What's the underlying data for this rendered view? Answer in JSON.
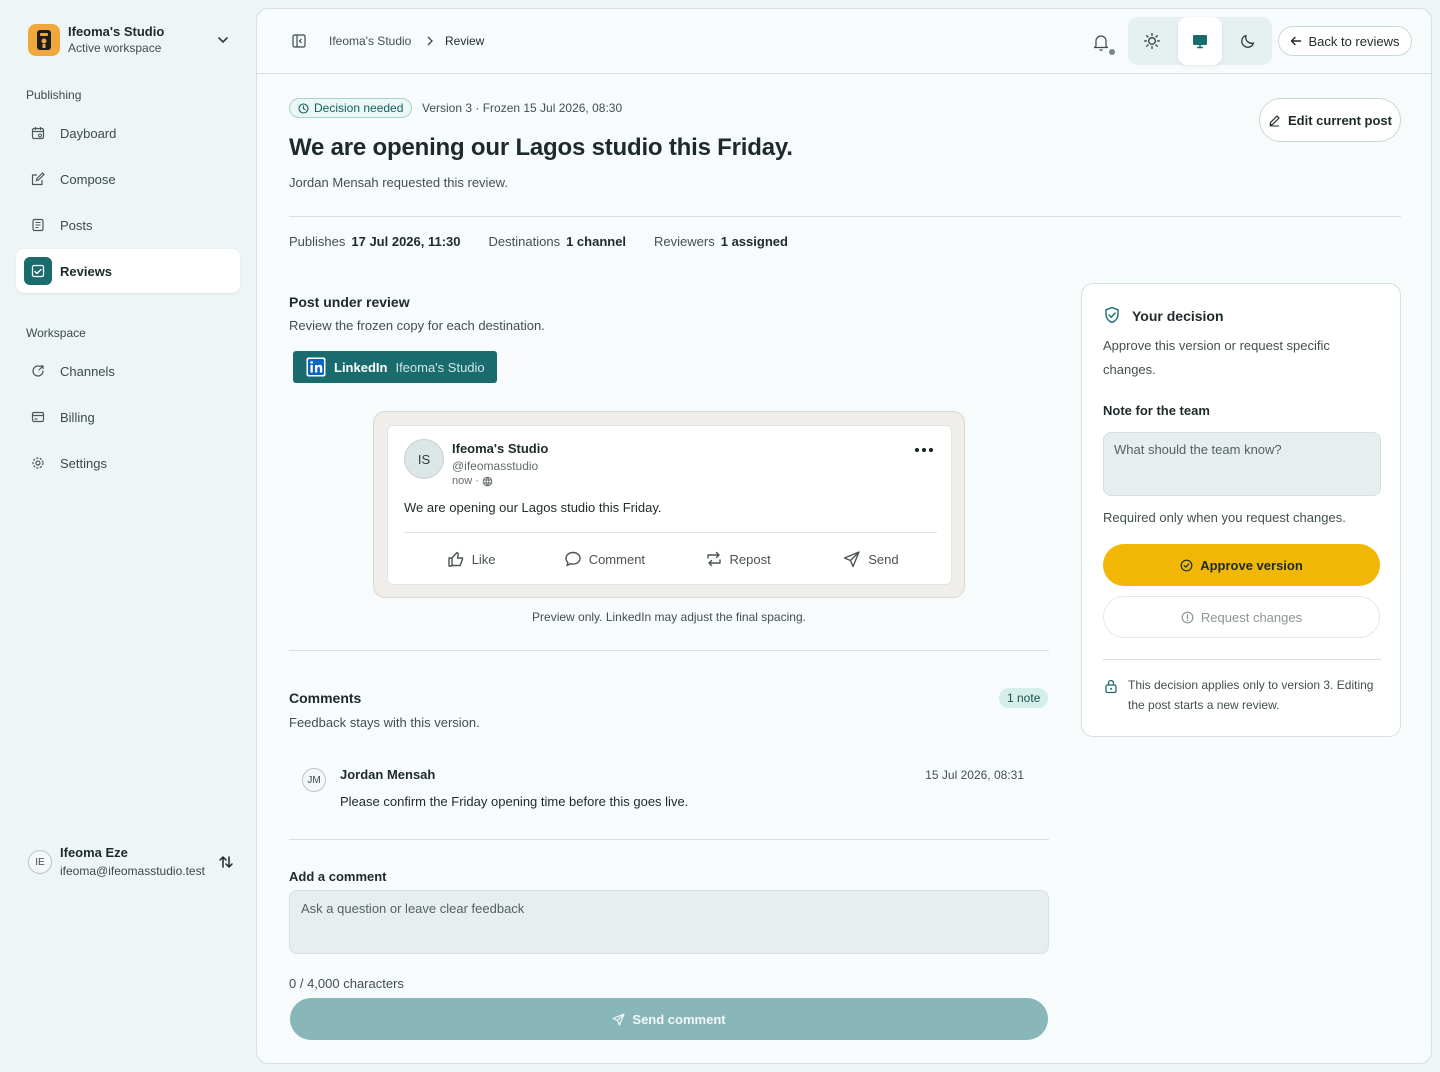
{
  "workspace": {
    "name": "Ifeoma's Studio",
    "subtitle": "Active workspace"
  },
  "nav": {
    "publishing_label": "Publishing",
    "workspace_label": "Workspace",
    "items": [
      {
        "label": "Dayboard",
        "icon": "calendar-icon"
      },
      {
        "label": "Compose",
        "icon": "compose-icon"
      },
      {
        "label": "Posts",
        "icon": "posts-icon"
      },
      {
        "label": "Reviews",
        "icon": "reviews-icon",
        "active": true
      },
      {
        "label": "Channels",
        "icon": "channels-icon"
      },
      {
        "label": "Billing",
        "icon": "billing-icon"
      },
      {
        "label": "Settings",
        "icon": "gear-icon"
      }
    ]
  },
  "user": {
    "initials": "IE",
    "name": "Ifeoma Eze",
    "email": "ifeoma@ifeomasstudio.test"
  },
  "topbar": {
    "breadcrumb": {
      "workspace": "Ifeoma's Studio",
      "current": "Review"
    },
    "theme_selected": "system",
    "back_label": "Back to reviews"
  },
  "review": {
    "status_badge": "Decision needed",
    "version_meta": "Version 3 · Frozen 15 Jul 2026, 08:30",
    "title": "We are opening our Lagos studio this Friday.",
    "requested_by": "Jordan Mensah requested this review.",
    "edit_label": "Edit current post",
    "meta": {
      "publishes_label": "Publishes",
      "publishes_value": "17 Jul 2026, 11:30",
      "destinations_label": "Destinations",
      "destinations_value": "1 channel",
      "reviewers_label": "Reviewers",
      "reviewers_value": "1 assigned"
    }
  },
  "post_review": {
    "title": "Post under review",
    "subtitle": "Review the frozen copy for each destination.",
    "channel": {
      "network": "LinkedIn",
      "account": "Ifeoma's Studio"
    },
    "preview": {
      "initials": "IS",
      "name": "Ifeoma's Studio",
      "handle": "@ifeomasstudio",
      "time": "now ·",
      "text": "We are opening our Lagos studio this Friday.",
      "actions": [
        "Like",
        "Comment",
        "Repost",
        "Send"
      ]
    },
    "note": "Preview only. LinkedIn may adjust the final spacing."
  },
  "comments": {
    "title": "Comments",
    "subtitle": "Feedback stays with this version.",
    "count_badge": "1 note",
    "items": [
      {
        "initials": "JM",
        "author": "Jordan Mensah",
        "time": "15 Jul 2026, 08:31",
        "text": "Please confirm the Friday opening time before this goes live."
      }
    ],
    "add_label": "Add a comment",
    "placeholder": "Ask a question or leave clear feedback",
    "char_count": "0 / 4,000 characters",
    "send_label": "Send comment"
  },
  "decision": {
    "title": "Your decision",
    "description": "Approve this version or request specific changes.",
    "note_label": "Note for the team",
    "note_placeholder": "What should the team know?",
    "note_help": "Required only when you request changes.",
    "approve_label": "Approve version",
    "request_label": "Request changes",
    "info": "This decision applies only to version 3. Editing the post starts a new review."
  },
  "colors": {
    "accent": "#1a6b6e",
    "approve": "#f2b705",
    "logo": "#f0a83c"
  }
}
